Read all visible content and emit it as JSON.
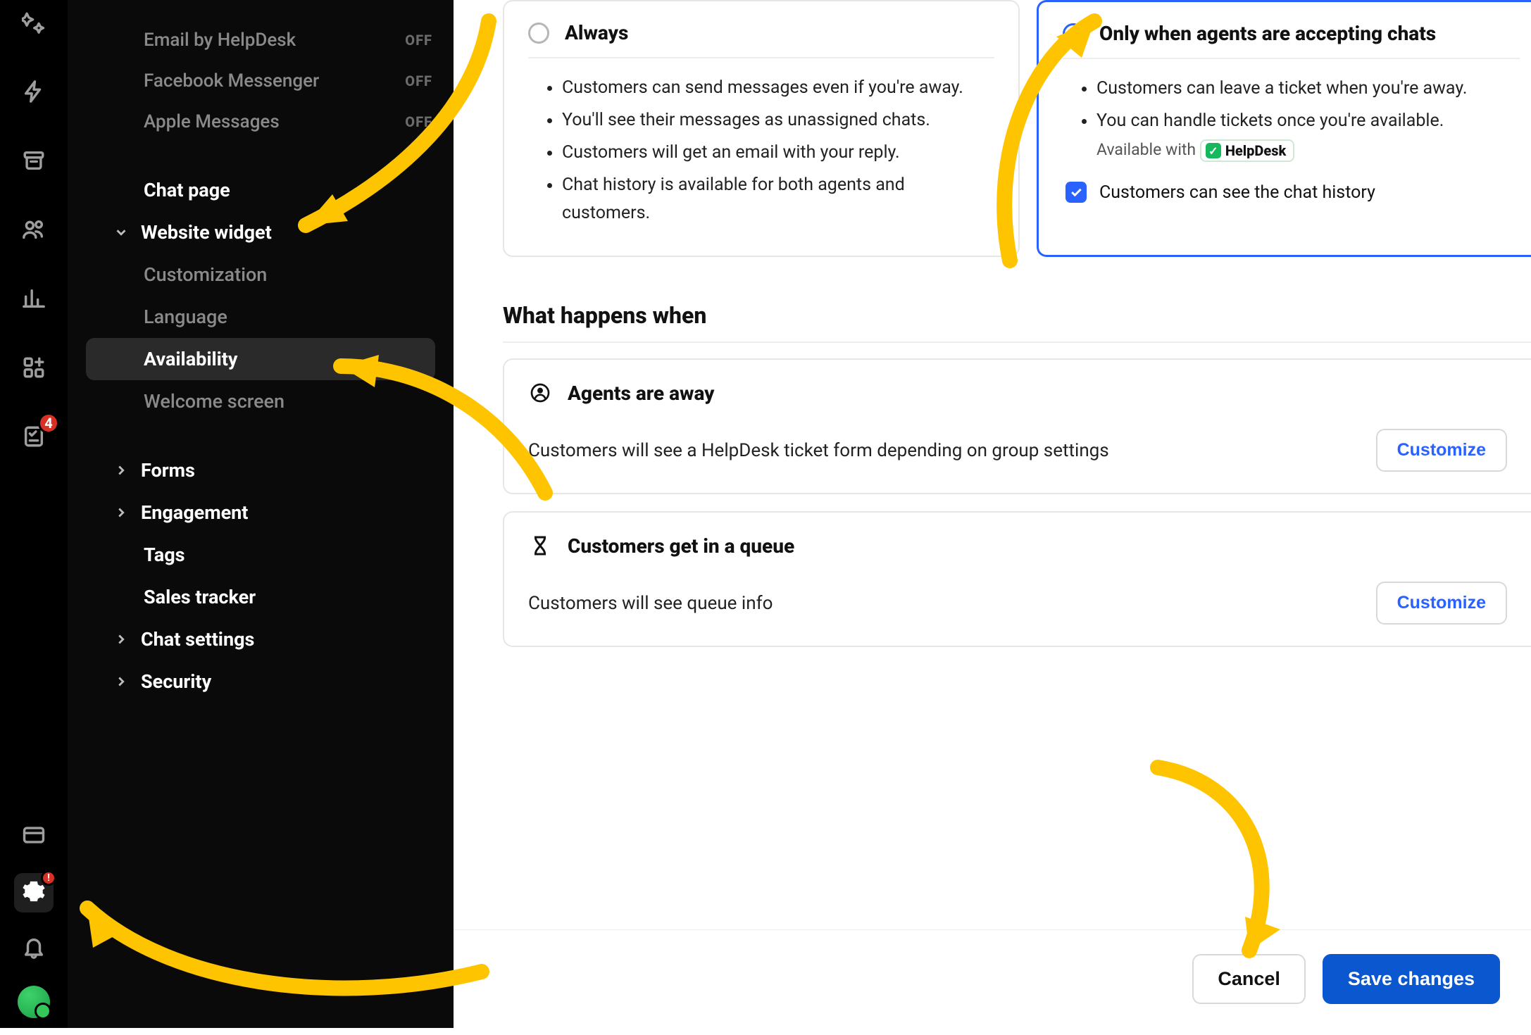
{
  "rail": {
    "items": [
      {
        "name": "sparkle-icon"
      },
      {
        "name": "bolt-icon"
      },
      {
        "name": "archive-icon"
      },
      {
        "name": "people-icon"
      },
      {
        "name": "chart-icon"
      },
      {
        "name": "apps-add-icon"
      },
      {
        "name": "checklist-icon",
        "badge": "4"
      }
    ],
    "bottom": [
      {
        "name": "card-icon"
      },
      {
        "name": "gear-icon",
        "active": true,
        "badge": "!"
      },
      {
        "name": "bell-icon"
      },
      {
        "name": "avatar"
      }
    ]
  },
  "sidebar": {
    "channels": [
      {
        "label": "Email by HelpDesk",
        "status": "OFF"
      },
      {
        "label": "Facebook Messenger",
        "status": "OFF"
      },
      {
        "label": "Apple Messages",
        "status": "OFF"
      }
    ],
    "items": [
      {
        "label": "Chat page",
        "expandable": false
      },
      {
        "label": "Website widget",
        "expandable": true,
        "expanded": true
      },
      {
        "label": "Customization",
        "sub": true
      },
      {
        "label": "Language",
        "sub": true
      },
      {
        "label": "Availability",
        "sub": true,
        "active": true
      },
      {
        "label": "Welcome screen",
        "sub": true
      },
      {
        "label": "Forms",
        "expandable": true
      },
      {
        "label": "Engagement",
        "expandable": true
      },
      {
        "label": "Tags",
        "expandable": false
      },
      {
        "label": "Sales tracker",
        "expandable": false
      },
      {
        "label": "Chat settings",
        "expandable": true
      },
      {
        "label": "Security",
        "expandable": true
      }
    ]
  },
  "options": {
    "always": {
      "title": "Always",
      "bullets": [
        "Customers can send messages even if you're away.",
        "You'll see their messages as unassigned chats.",
        "Customers will get an email with your reply.",
        "Chat history is available for both agents and customers."
      ],
      "selected": false
    },
    "onlyAccepting": {
      "title": "Only when agents are accepting chats",
      "bullets": [
        "Customers can leave a ticket when you're away.",
        "You can handle tickets once you're available."
      ],
      "available_with_prefix": "Available with",
      "helpdesk_badge": "HelpDesk",
      "checkbox_label": "Customers can see the chat history",
      "checkbox_checked": true,
      "selected": true
    }
  },
  "section": {
    "heading": "What happens when",
    "rows": [
      {
        "icon": "agent-away-icon",
        "title": "Agents are away",
        "desc": "Customers will see a HelpDesk ticket form depending on group settings",
        "button": "Customize"
      },
      {
        "icon": "hourglass-icon",
        "title": "Customers get in a queue",
        "desc": "Customers will see queue info",
        "button": "Customize"
      }
    ]
  },
  "footer": {
    "cancel": "Cancel",
    "save": "Save changes"
  }
}
